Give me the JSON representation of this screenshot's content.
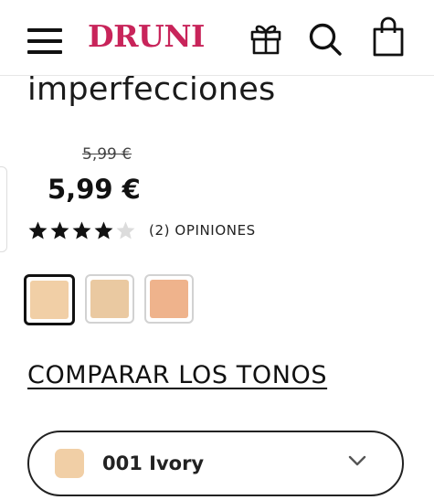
{
  "header": {
    "logo": "DRUNI",
    "brand_color": "#c8245a",
    "icons": [
      "menu-icon",
      "gift-icon",
      "search-icon",
      "bag-icon"
    ]
  },
  "product": {
    "title": "imperfecciones",
    "old_price": "5,99 €",
    "price": "5,99 €",
    "rating": 4,
    "rating_max": 5,
    "reviews_label": "(2) OPINIONES"
  },
  "swatches": [
    {
      "color": "#f1cfa6",
      "selected": true
    },
    {
      "color": "#eac9a1",
      "selected": false
    },
    {
      "color": "#efb38c",
      "selected": false
    }
  ],
  "compare_link": "COMPARAR LOS TONOS",
  "shade_select": {
    "value": "001 Ivory",
    "color": "#f1cfa6"
  }
}
